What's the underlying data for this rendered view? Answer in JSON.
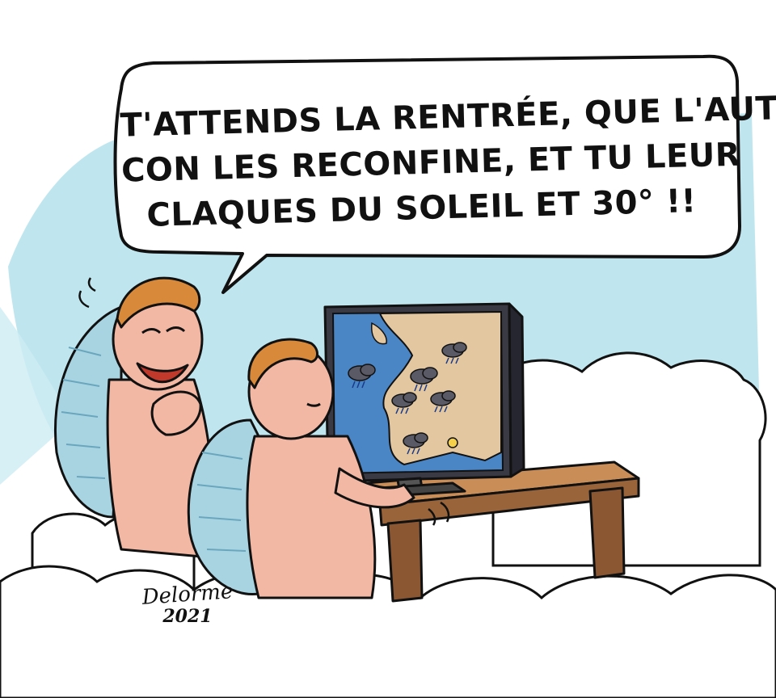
{
  "speech_bubble": {
    "lines": [
      "T'ATTENDS LA RENTRÉE, QUE L'AUTRE",
      "CON LES RECONFINE, ET TU LEUR",
      "CLAQUES DU SOLEIL ET 30° !!"
    ]
  },
  "signature": {
    "name": "Delorme",
    "year": "2021"
  },
  "colors": {
    "sky": "#bfe6ee",
    "cloud": "#ffffff",
    "skin": "#f2b8a4",
    "hair": "#d88a3a",
    "wing": "#a8d4e2",
    "desk": "#b07a4a",
    "sea": "#4a86c6",
    "land": "#e2c7a0"
  },
  "icons": [
    "rain-cloud-icon",
    "sun-icon"
  ]
}
